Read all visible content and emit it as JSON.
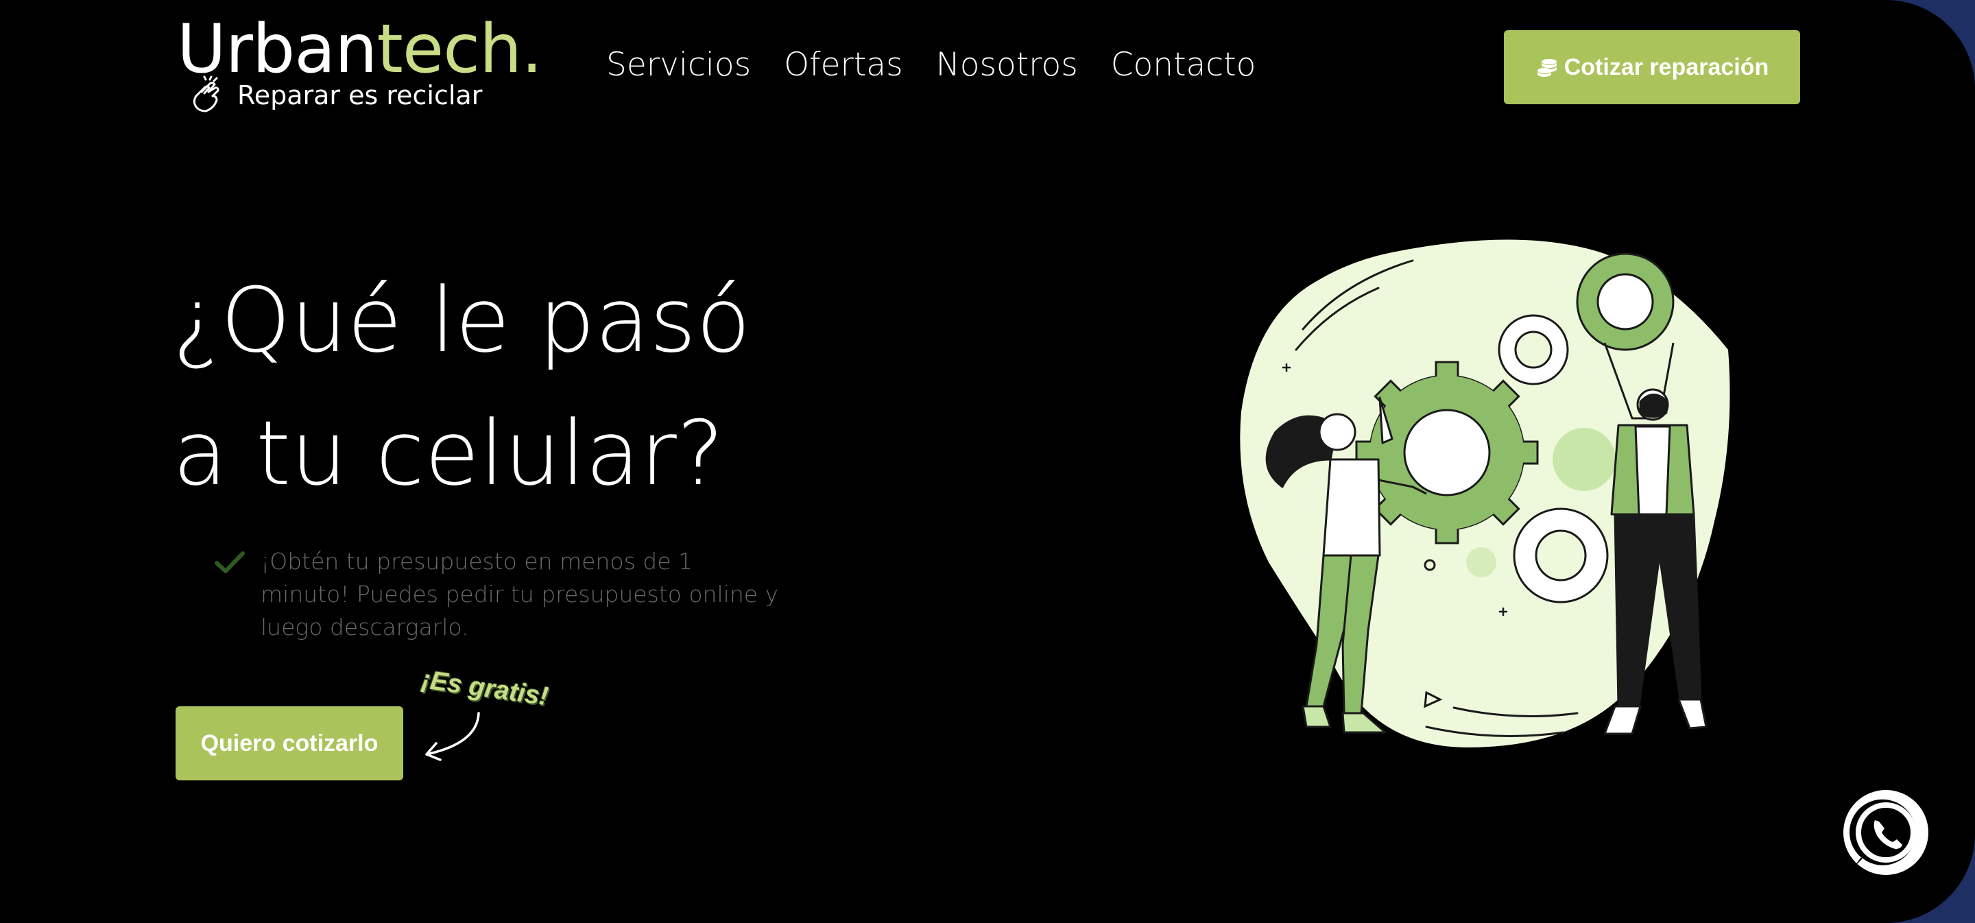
{
  "brand": {
    "name_main": "Urban",
    "name_accent": "tech.",
    "tagline": "Reparar es reciclar",
    "accent_color": "#c8dd85"
  },
  "nav": {
    "items": [
      {
        "label": "Servicios"
      },
      {
        "label": "Ofertas"
      },
      {
        "label": "Nosotros"
      },
      {
        "label": "Contacto"
      }
    ]
  },
  "header": {
    "quote_button_label": "Cotizar reparación",
    "quote_button_icon": "coins-icon",
    "button_color": "#aac45b"
  },
  "hero": {
    "title_line1": "¿Qué le pasó",
    "title_line2": "a tu celular?",
    "feature_icon": "check-icon",
    "feature_text": "¡Obtén tu presupuesto en menos de 1 minuto! Puedes pedir tu presupuesto online y luego descargarlo.",
    "cta_label": "Quiero cotizarlo",
    "free_badge": "¡Es gratis!",
    "illustration_icon": "gears-teamwork-illustration"
  },
  "whatsapp": {
    "icon": "whatsapp-icon"
  }
}
